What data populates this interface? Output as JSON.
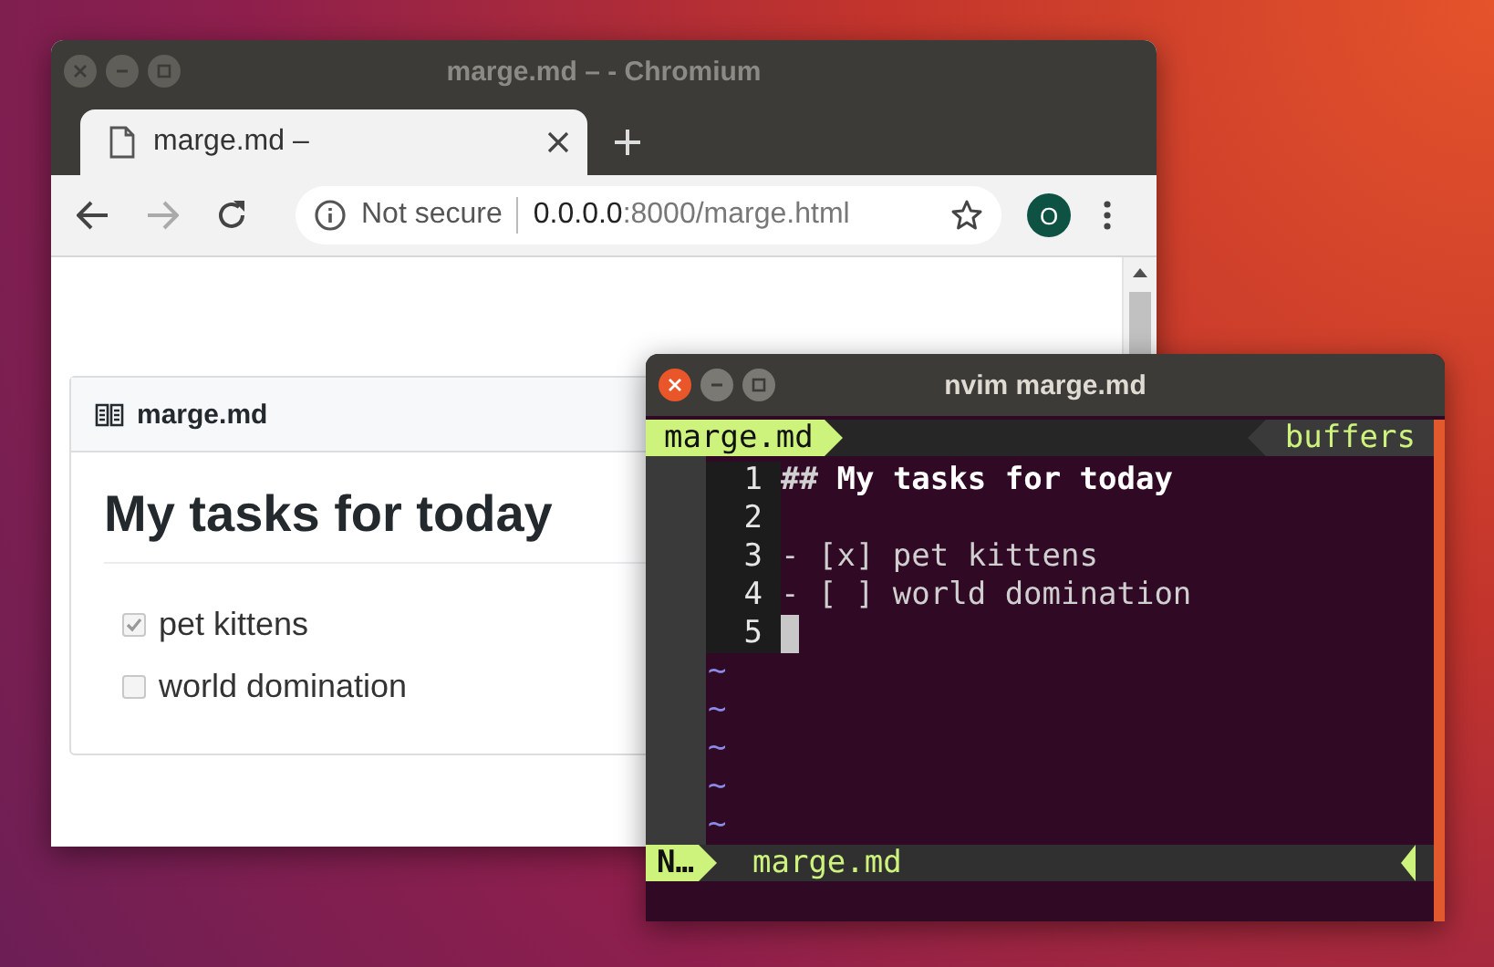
{
  "browser": {
    "title": "marge.md – - Chromium",
    "tabs": [
      {
        "title": "marge.md –",
        "selected": true
      }
    ],
    "toolbar": {
      "security": "Not secure",
      "url_host": "0.0.0.0",
      "url_rest": ":8000/marge.html",
      "profile": "O"
    },
    "card": {
      "filename": "marge.md",
      "heading": "My tasks for today",
      "tasks": [
        {
          "label": "pet kittens",
          "checked": true
        },
        {
          "label": "world domination",
          "checked": false
        }
      ]
    }
  },
  "nvim": {
    "title": "nvim marge.md",
    "tabline": {
      "buffer": "marge.md",
      "right": "buffers"
    },
    "lines": [
      {
        "number": "1",
        "kind": "heading",
        "marker": "##",
        "text": "My tasks for today",
        "cursor": false
      },
      {
        "number": "2",
        "kind": "plain",
        "cursor": false
      },
      {
        "number": "3",
        "kind": "plain",
        "text": "- [x] pet kittens",
        "cursor": false
      },
      {
        "number": "4",
        "kind": "plain",
        "text": "- [ ] world domination",
        "cursor": false
      },
      {
        "number": "5",
        "kind": "plain",
        "cursor": true
      }
    ],
    "tildes": [
      "~",
      "~",
      "~",
      "~",
      "~"
    ],
    "statusline": {
      "mode": "N…",
      "file": "marge.md"
    }
  }
}
